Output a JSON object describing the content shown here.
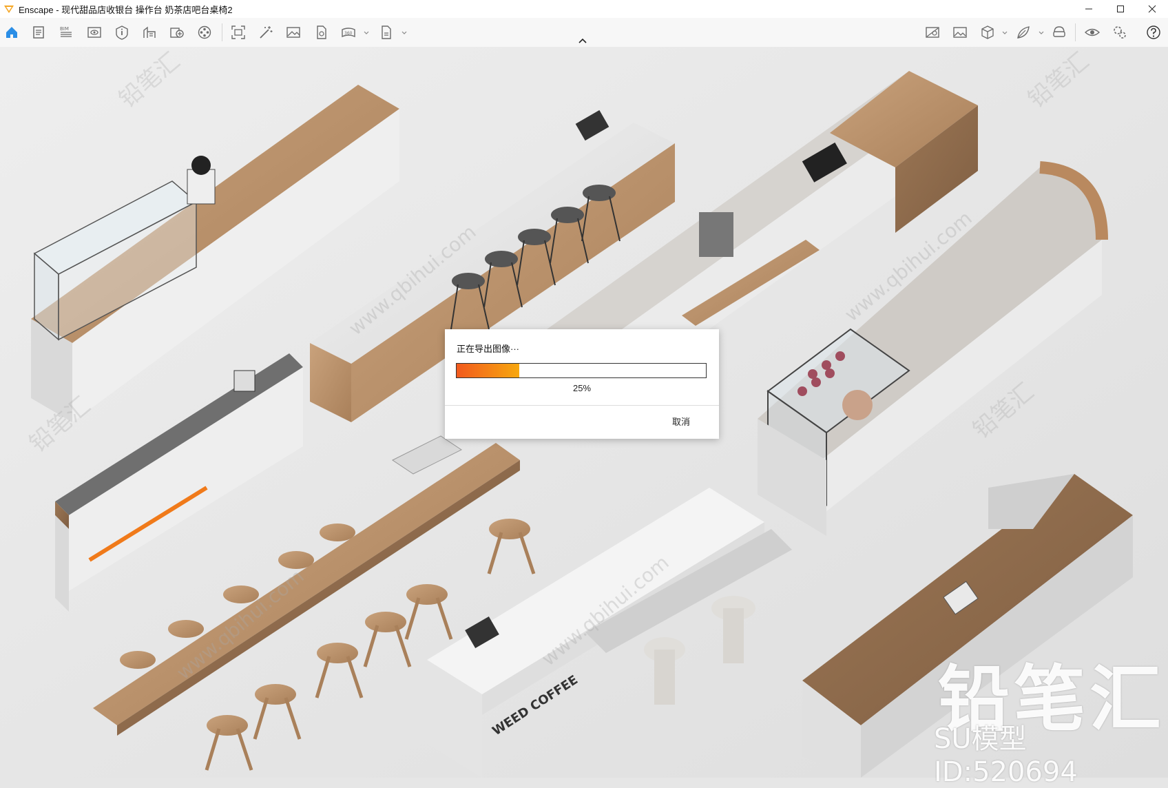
{
  "window": {
    "title": "Enscape - 现代甜品店收银台 操作台 奶茶店吧台桌椅2",
    "controls": {
      "minimize": "minimize",
      "maximize": "maximize",
      "close": "close"
    }
  },
  "toolbar": {
    "left_icons": [
      "home-icon",
      "document-icon",
      "bim-icon",
      "view-icon",
      "info-icon",
      "asset-library-icon",
      "material-icon",
      "video-editor-icon",
      "screenshot-icon",
      "batch-render-icon",
      "image-export-icon",
      "web-export-icon",
      "panorama-360-icon",
      "exe-export-icon"
    ],
    "right_icons": [
      "visual-settings-icon",
      "image-view-icon",
      "cube-view-icon",
      "materials-icon",
      "vr-headset-icon",
      "eye-icon",
      "settings-icon",
      "help-icon"
    ],
    "bim_label": "BIM"
  },
  "dialog": {
    "title": "正在导出图像···",
    "progress": 0.25,
    "progress_label": "25%",
    "cancel_label": "取消"
  },
  "watermark": {
    "brand": "铅笔汇",
    "model_id": "SU模型ID:520694",
    "url": "www.qbihui.com",
    "small_brand": "铅笔汇"
  },
  "scene": {
    "signage_text": "WEED COFFEE"
  },
  "colors": {
    "accent_orange": "#f5a623",
    "progress_start": "#f25a1e",
    "progress_end": "#f7a80f",
    "toolbar_icon": "#6a6a6a",
    "home_icon": "#2b8ee6"
  }
}
